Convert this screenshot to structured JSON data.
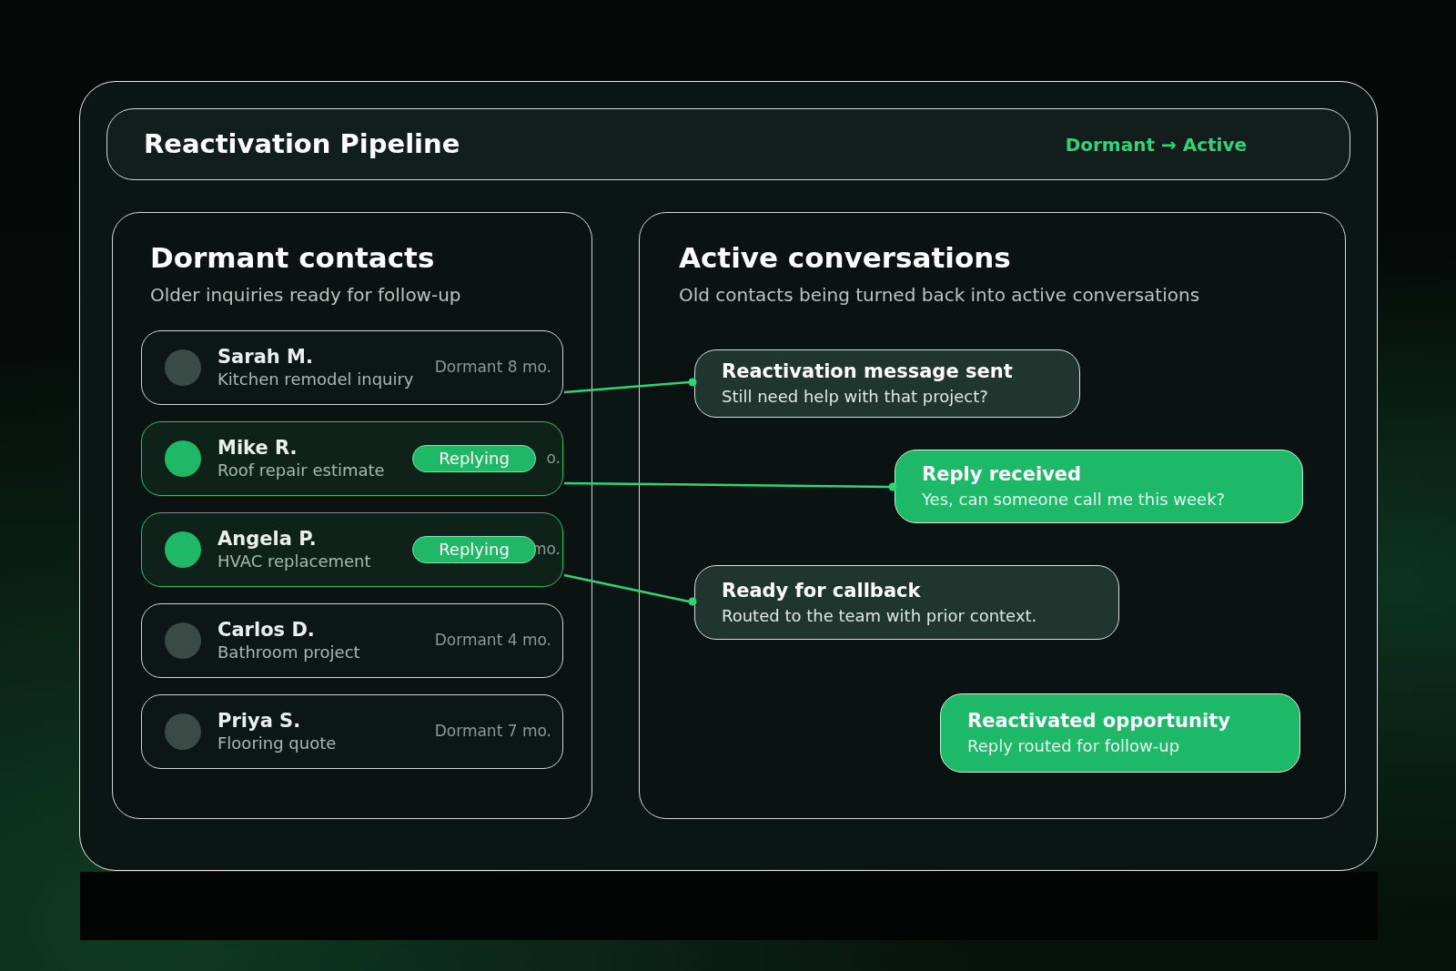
{
  "header": {
    "title": "Reactivation Pipeline",
    "flow": "Dormant → Active"
  },
  "dormant": {
    "title": "Dormant contacts",
    "subtitle": "Older inquiries ready for follow-up",
    "contacts": [
      {
        "name": "Sarah M.",
        "detail": "Kitchen remodel inquiry",
        "kind": "dormant",
        "status_text": "Dormant 8 mo."
      },
      {
        "name": "Mike R.",
        "detail": "Roof repair estimate",
        "kind": "replying",
        "badge": "Replying",
        "status_text": "o."
      },
      {
        "name": "Angela P.",
        "detail": "HVAC replacement",
        "kind": "replying",
        "badge": "Replying",
        "status_text": "mo."
      },
      {
        "name": "Carlos D.",
        "detail": "Bathroom project",
        "kind": "dormant",
        "status_text": "Dormant 4 mo."
      },
      {
        "name": "Priya S.",
        "detail": "Flooring quote",
        "kind": "dormant",
        "status_text": "Dormant 7 mo."
      }
    ]
  },
  "active": {
    "title": "Active conversations",
    "subtitle": "Old contacts being turned back into active conversations",
    "cards": [
      {
        "kind": "dark",
        "title": "Reactivation message sent",
        "detail": "Still need help with that project?"
      },
      {
        "kind": "green",
        "title": "Reply received",
        "detail": "Yes, can someone call me this week?"
      },
      {
        "kind": "dark",
        "title": "Ready for callback",
        "detail": "Routed to the team with prior context."
      },
      {
        "kind": "green",
        "title": "Reactivated opportunity",
        "detail": "Reply routed for follow-up"
      }
    ]
  }
}
